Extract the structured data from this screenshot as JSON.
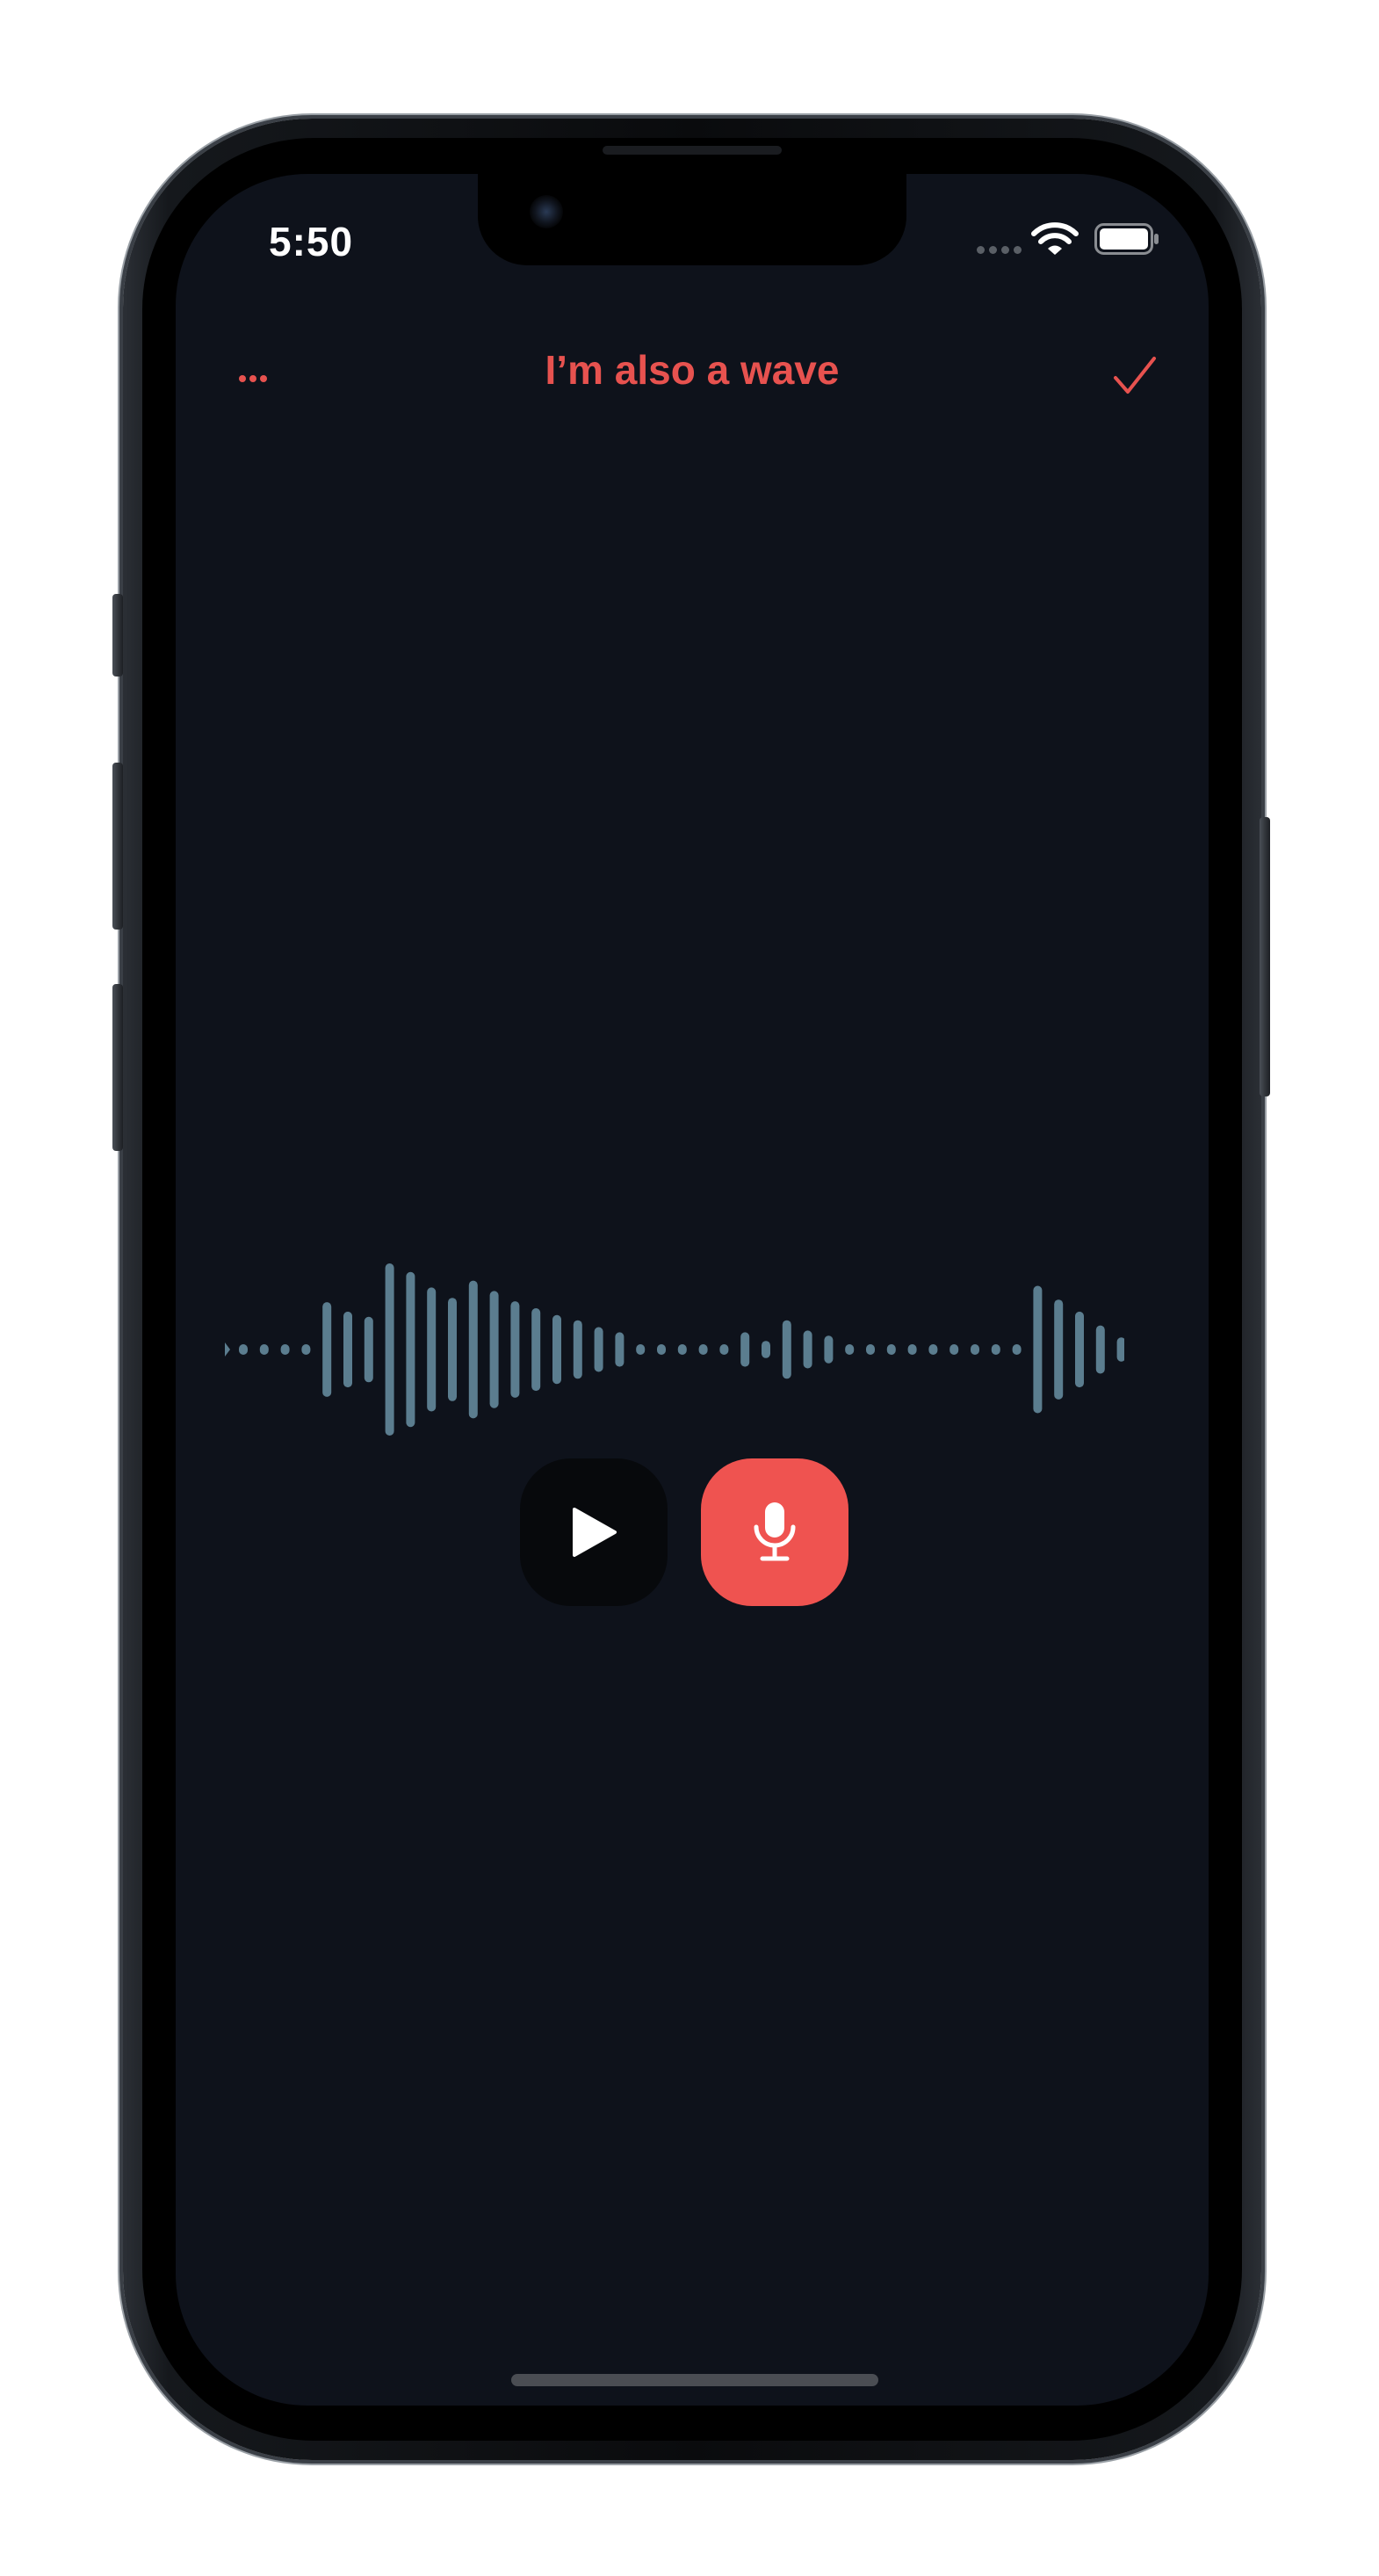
{
  "status_bar": {
    "time": "5:50",
    "icons": [
      "cellular-signal-icon",
      "wifi-icon",
      "battery-icon"
    ]
  },
  "nav": {
    "more_icon": "ellipsis-icon",
    "title": "I’m also a wave",
    "done_icon": "checkmark-icon"
  },
  "waveform": {
    "bar_color": "#5b7d8f",
    "bar_levels": [
      0.02,
      0.02,
      0.02,
      0.02,
      0.55,
      0.44,
      0.38,
      1.0,
      0.9,
      0.72,
      0.6,
      0.8,
      0.68,
      0.56,
      0.48,
      0.4,
      0.34,
      0.26,
      0.2,
      0.02,
      0.02,
      0.02,
      0.02,
      0.02,
      0.2,
      0.1,
      0.34,
      0.22,
      0.16,
      0.02,
      0.02,
      0.02,
      0.02,
      0.02,
      0.02,
      0.02,
      0.02,
      0.02,
      0.74,
      0.58,
      0.44,
      0.28,
      0.14
    ]
  },
  "controls": {
    "play_icon": "play-icon",
    "record_icon": "microphone-icon"
  },
  "colors": {
    "accent": "#e7524f",
    "record_button": "#ef5350",
    "background": "#0e121b",
    "play_button": "#07090c"
  }
}
